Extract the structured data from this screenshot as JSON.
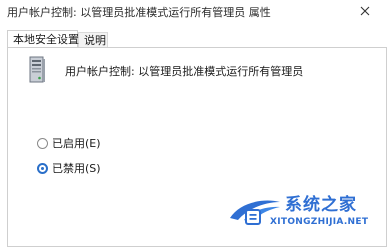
{
  "window": {
    "title": "用户帐户控制: 以管理员批准模式运行所有管理员 属性"
  },
  "tabs": [
    {
      "label": "本地安全设置",
      "active": true
    },
    {
      "label": "说明",
      "active": false
    }
  ],
  "policy": {
    "name": "用户帐户控制: 以管理员批准模式运行所有管理员",
    "icon": "server-icon"
  },
  "options": [
    {
      "label": "已启用(E)",
      "selected": false
    },
    {
      "label": "已禁用(S)",
      "selected": true
    }
  ],
  "watermark": {
    "cn": "系统之家",
    "en": "XITONGZHIJIA.NET"
  },
  "colors": {
    "accent": "#2a6fc9",
    "watermark": "#2f6fd3"
  }
}
